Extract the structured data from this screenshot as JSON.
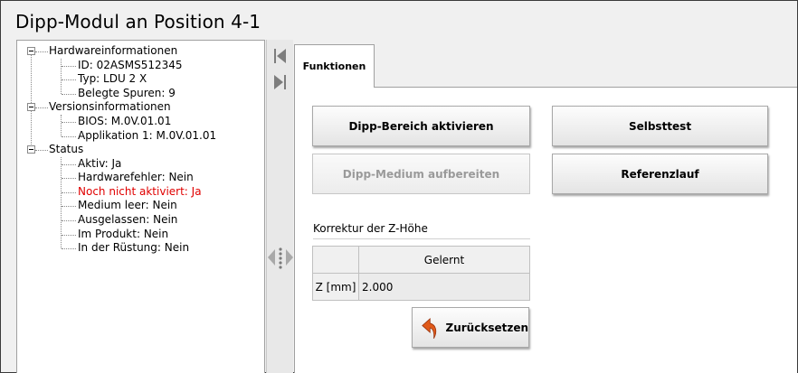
{
  "window": {
    "title": "Dipp-Modul an Position 4-1"
  },
  "tree": {
    "groups": [
      {
        "label": "Hardwareinformationen",
        "items": [
          "ID: 02ASMS512345",
          "Typ: LDU 2 X",
          "Belegte Spuren: 9"
        ]
      },
      {
        "label": "Versionsinformationen",
        "items": [
          "BIOS: M.0V.01.01",
          "Applikation 1: M.0V.01.01"
        ]
      },
      {
        "label": "Status",
        "items": [
          "Aktiv: Ja",
          "Hardwarefehler: Nein",
          "Noch nicht aktiviert: Ja",
          "Medium leer: Nein",
          "Ausgelassen: Nein",
          "Im Produkt: Nein",
          "In der Rüstung: Nein"
        ]
      }
    ],
    "warning_color": "#e00000"
  },
  "tabs": [
    {
      "label": "Funktionen",
      "active": true
    }
  ],
  "buttons": {
    "activate": "Dipp-Bereich aktivieren",
    "selftest": "Selbsttest",
    "prepare": "Dipp-Medium aufbereiten",
    "reference": "Referenzlauf",
    "reset": "Zurücksetzen"
  },
  "correction": {
    "title": "Korrektur der Z-Höhe",
    "column_header": "Gelernt",
    "row_label": "Z [mm]",
    "value": "2.000"
  },
  "icons": {
    "nav_first": "first-page-icon",
    "nav_last": "last-page-icon",
    "splitter": "splitter-grip-icon",
    "reset": "undo-arrow-icon",
    "reset_color": "#e05a1a"
  }
}
